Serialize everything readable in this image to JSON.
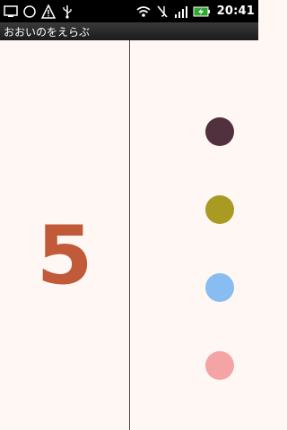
{
  "status_bar": {
    "time": "20:41",
    "icons_left": [
      "screen-icon",
      "circle-icon",
      "warning-icon",
      "usb-icon"
    ],
    "icons_right": [
      "wifi-icon",
      "vibrate-icon",
      "signal-icon",
      "battery-charging-icon"
    ]
  },
  "app": {
    "title": "おおいのをえらぶ"
  },
  "game": {
    "number": "5",
    "number_color": "#c05a38",
    "dots": [
      {
        "color": "#51313d"
      },
      {
        "color": "#a99a21"
      },
      {
        "color": "#87bdf0"
      },
      {
        "color": "#f4a4a4"
      }
    ]
  },
  "colors": {
    "background": "#fff7f4",
    "divider": "#4a4a4a",
    "status_bar": "#000000",
    "title_bar": "#2a2a2a"
  }
}
